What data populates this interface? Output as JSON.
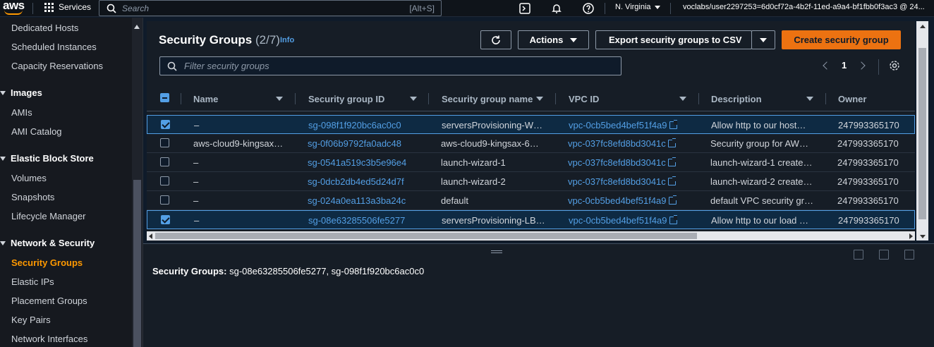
{
  "topnav": {
    "logo": "aws",
    "services_label": "Services",
    "search_placeholder": "Search",
    "search_shortcut": "[Alt+S]",
    "region": "N. Virginia",
    "account": "voclabs/user2297253=6d0cf72a-4b2f-11ed-a9a4-bf1fbb0f3ac3 @ 24..."
  },
  "sidebar": {
    "items": [
      {
        "label": "Dedicated Hosts",
        "type": "item"
      },
      {
        "label": "Scheduled Instances",
        "type": "item"
      },
      {
        "label": "Capacity Reservations",
        "type": "item"
      },
      {
        "label": "Images",
        "type": "header"
      },
      {
        "label": "AMIs",
        "type": "item"
      },
      {
        "label": "AMI Catalog",
        "type": "item"
      },
      {
        "label": "Elastic Block Store",
        "type": "header"
      },
      {
        "label": "Volumes",
        "type": "item"
      },
      {
        "label": "Snapshots",
        "type": "item"
      },
      {
        "label": "Lifecycle Manager",
        "type": "item"
      },
      {
        "label": "Network & Security",
        "type": "header"
      },
      {
        "label": "Security Groups",
        "type": "active"
      },
      {
        "label": "Elastic IPs",
        "type": "item"
      },
      {
        "label": "Placement Groups",
        "type": "item"
      },
      {
        "label": "Key Pairs",
        "type": "item"
      },
      {
        "label": "Network Interfaces",
        "type": "item"
      }
    ]
  },
  "main": {
    "title": "Security Groups",
    "count": "(2/7)",
    "info": "Info",
    "actions_label": "Actions",
    "export_label": "Export security groups to CSV",
    "create_label": "Create security group",
    "filter_placeholder": "Filter security groups",
    "page": "1",
    "columns": [
      "Name",
      "Security group ID",
      "Security group name",
      "VPC ID",
      "Description",
      "Owner"
    ],
    "rows": [
      {
        "selected": true,
        "name": "–",
        "sg_id": "sg-098f1f920bc6ac0c0",
        "sg_name": "serversProvisioning-W…",
        "vpc": "vpc-0cb5bed4bef51f4a9",
        "desc": "Allow http to our host…",
        "owner": "247993365170"
      },
      {
        "selected": false,
        "name": "aws-cloud9-kingsax…",
        "sg_id": "sg-0f06b9792fa0adc48",
        "sg_name": "aws-cloud9-kingsax-6…",
        "vpc": "vpc-037fc8efd8bd3041c",
        "desc": "Security group for AW…",
        "owner": "247993365170"
      },
      {
        "selected": false,
        "name": "–",
        "sg_id": "sg-0541a519c3b5e96e4",
        "sg_name": "launch-wizard-1",
        "vpc": "vpc-037fc8efd8bd3041c",
        "desc": "launch-wizard-1 create…",
        "owner": "247993365170"
      },
      {
        "selected": false,
        "name": "–",
        "sg_id": "sg-0dcb2db4ed5d24d7f",
        "sg_name": "launch-wizard-2",
        "vpc": "vpc-037fc8efd8bd3041c",
        "desc": "launch-wizard-2 create…",
        "owner": "247993365170"
      },
      {
        "selected": false,
        "name": "–",
        "sg_id": "sg-024a0ea113a3ba24c",
        "sg_name": "default",
        "vpc": "vpc-0cb5bed4bef51f4a9",
        "desc": "default VPC security gr…",
        "owner": "247993365170"
      },
      {
        "selected": true,
        "name": "–",
        "sg_id": "sg-08e63285506fe5277",
        "sg_name": "serversProvisioning-LB…",
        "vpc": "vpc-0cb5bed4bef51f4a9",
        "desc": "Allow http to our load …",
        "owner": "247993365170"
      }
    ]
  },
  "bottom": {
    "label": "Security Groups:",
    "value": "sg-08e63285506fe5277, sg-098f1f920bc6ac0c0"
  },
  "colors": {
    "accent": "#ec7211",
    "link": "#539fe5",
    "active_nav": "#ff9900"
  }
}
